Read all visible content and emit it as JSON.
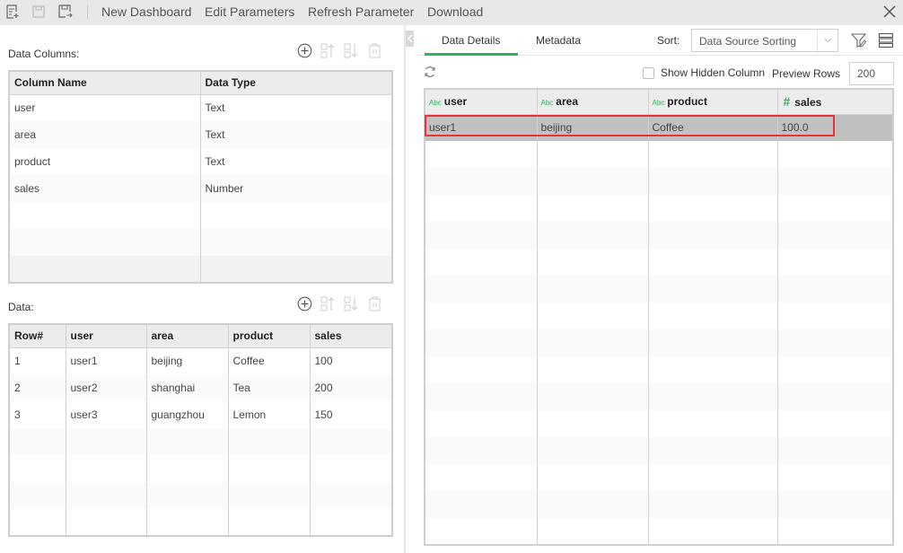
{
  "toolbar": {
    "icons": [
      "new-document-icon",
      "save-icon",
      "save-as-icon"
    ],
    "links": [
      "New Dashboard",
      "Edit Parameters",
      "Refresh Parameter",
      "Download"
    ],
    "close_icon": "close-icon"
  },
  "left": {
    "columns_section": {
      "label": "Data Columns:",
      "headers": [
        "Column Name",
        "Data Type"
      ],
      "rows": [
        [
          "user",
          "Text"
        ],
        [
          "area",
          "Text"
        ],
        [
          "product",
          "Text"
        ],
        [
          "sales",
          "Number"
        ]
      ]
    },
    "data_section": {
      "label": "Data:",
      "headers": [
        "Row#",
        "user",
        "area",
        "product",
        "sales"
      ],
      "rows": [
        [
          "1",
          "user1",
          "beijing",
          "Coffee",
          "100"
        ],
        [
          "2",
          "user2",
          "shanghai",
          "Tea",
          "200"
        ],
        [
          "3",
          "user3",
          "guangzhou",
          "Lemon",
          "150"
        ]
      ]
    },
    "action_icons": [
      "add-icon",
      "move-up-icon",
      "move-down-icon",
      "delete-icon"
    ]
  },
  "right": {
    "tabs": [
      {
        "label": "Data Details",
        "active": true
      },
      {
        "label": "Metadata",
        "active": false
      }
    ],
    "sort_label": "Sort:",
    "sort_value": "Data Source Sorting",
    "show_hidden_label": "Show Hidden Column",
    "show_hidden_checked": false,
    "preview_rows_label": "Preview Rows",
    "preview_rows_value": "200",
    "grid": {
      "headers": [
        {
          "type": "Abc",
          "name": "user"
        },
        {
          "type": "Abc",
          "name": "area"
        },
        {
          "type": "Abc",
          "name": "product"
        },
        {
          "type": "#",
          "name": "sales"
        }
      ],
      "rows": [
        [
          "user1",
          "beijing",
          "Coffee",
          "100.0"
        ]
      ],
      "selected_row": 0
    }
  },
  "colors": {
    "accent_green": "#2db55d",
    "highlight_red": "#e8333a",
    "selected_row": "#c0c0c0"
  }
}
